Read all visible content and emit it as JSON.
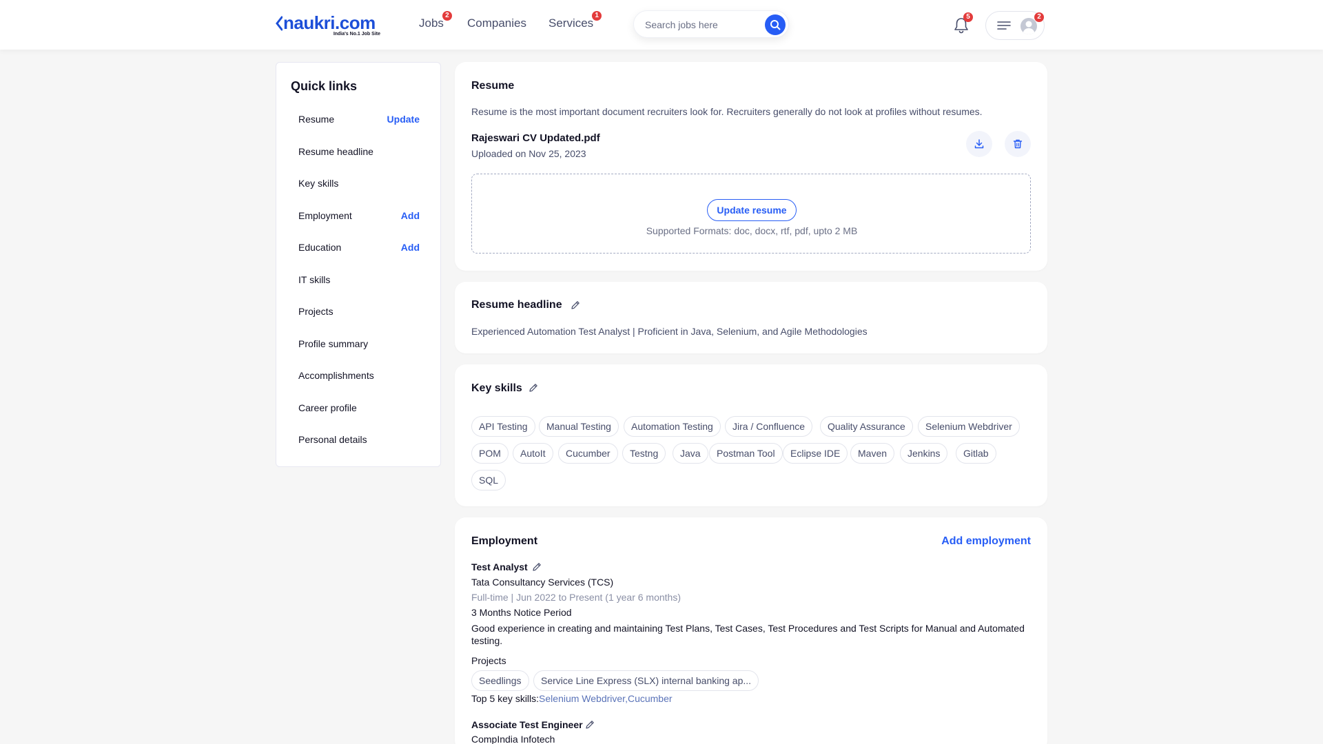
{
  "header": {
    "logo_text": "naukri.com",
    "logo_tagline": "India's No.1 Job Site",
    "nav": [
      {
        "label": "Jobs",
        "badge": "2"
      },
      {
        "label": "Companies",
        "badge": ""
      },
      {
        "label": "Services",
        "badge": "1"
      }
    ],
    "search_placeholder": "Search jobs here",
    "notification_count": "5",
    "menu_badge": "2"
  },
  "quick_links": {
    "title": "Quick links",
    "items": [
      {
        "label": "Resume",
        "action": "Update"
      },
      {
        "label": "Resume headline",
        "action": ""
      },
      {
        "label": "Key skills",
        "action": ""
      },
      {
        "label": "Employment",
        "action": "Add"
      },
      {
        "label": "Education",
        "action": "Add"
      },
      {
        "label": "IT skills",
        "action": ""
      },
      {
        "label": "Projects",
        "action": ""
      },
      {
        "label": "Profile summary",
        "action": ""
      },
      {
        "label": "Accomplishments",
        "action": ""
      },
      {
        "label": "Career profile",
        "action": ""
      },
      {
        "label": "Personal details",
        "action": ""
      }
    ]
  },
  "resume": {
    "title": "Resume",
    "description": "Resume is the most important document recruiters look for. Recruiters generally do not look at profiles without resumes.",
    "file_name": "Rajeswari CV Updated.pdf",
    "uploaded": "Uploaded on Nov 25, 2023",
    "update_label": "Update resume",
    "formats": "Supported Formats: doc, docx, rtf, pdf, upto 2 MB"
  },
  "headline": {
    "title": "Resume headline",
    "text": "Experienced Automation Test Analyst | Proficient in Java, Selenium, and Agile Methodologies"
  },
  "key_skills": {
    "title": "Key skills",
    "rows": [
      [
        "API Testing",
        "Manual Testing",
        "Automation Testing",
        "Jira / Confluence",
        "Quality Assurance",
        "Selenium Webdriver"
      ],
      [
        "POM",
        "AutoIt",
        "Cucumber",
        "Testng",
        "Java",
        "Postman Tool",
        "Eclipse IDE",
        "Maven",
        "Jenkins",
        "Gitlab"
      ],
      [
        "SQL"
      ]
    ]
  },
  "employment": {
    "title": "Employment",
    "add_label": "Add employment",
    "jobs": [
      {
        "role": "Test Analyst",
        "company": "Tata Consultancy Services (TCS)",
        "duration": "Full-time | Jun 2022 to Present (1 year 6 months)",
        "notice": "3 Months Notice Period",
        "description": "Good experience in creating and maintaining Test Plans, Test Cases, Test Procedures and Test Scripts for Manual and Automated testing.",
        "projects_label": "Projects",
        "projects": [
          "Seedlings",
          "Service Line Express (SLX) internal banking ap..."
        ],
        "skills_label": "Top 5 key skills:",
        "skills": "Selenium Webdriver,Cucumber"
      },
      {
        "role": "Associate Test Engineer",
        "company": "CompIndia Infotech"
      }
    ]
  },
  "colors": {
    "accent": "#275df5",
    "badge": "#e33b3b",
    "background": "#f6f6f6"
  }
}
